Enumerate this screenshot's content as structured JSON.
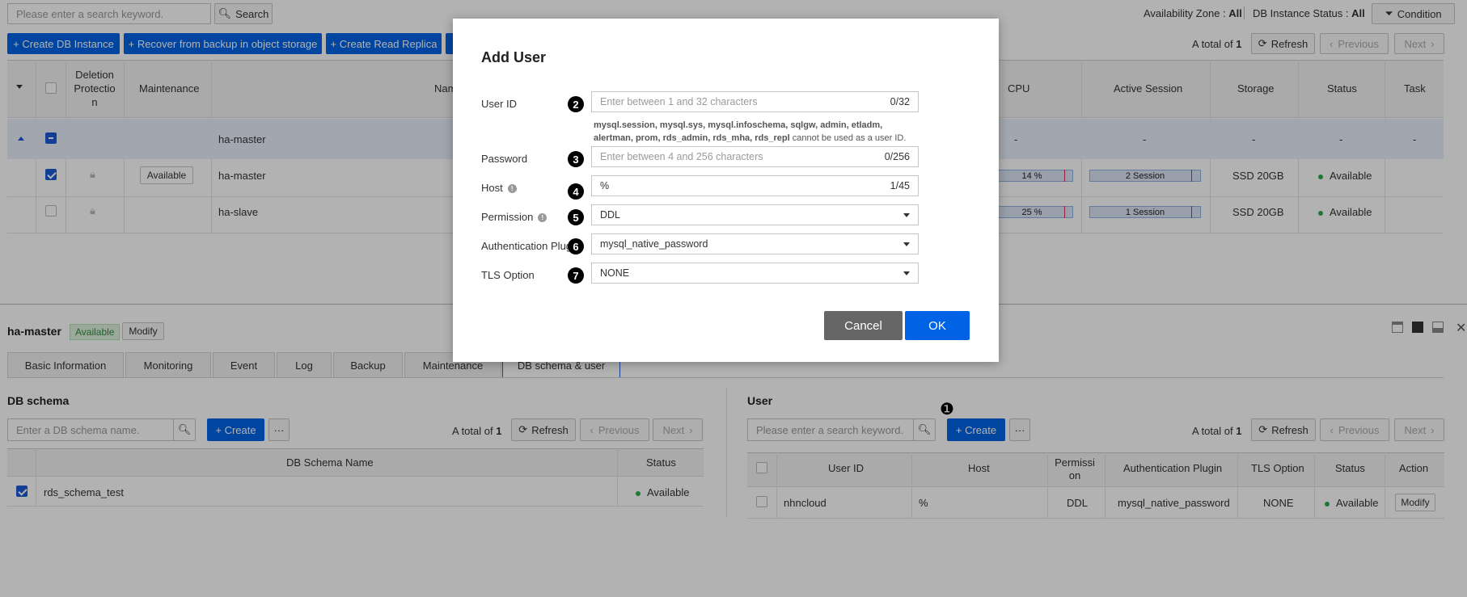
{
  "top_search": {
    "placeholder": "Please enter a search keyword.",
    "button": "Search"
  },
  "filters": {
    "az_label": "Availability Zone :",
    "az_value": "All",
    "status_label": "DB Instance Status :",
    "status_value": "All",
    "condition": "Condition"
  },
  "toolbar": {
    "create": "+ Create DB Instance",
    "recover": "+ Recover from backup in object storage",
    "replica": "+ Create Read Replica",
    "total_label": "A total of",
    "total": "1",
    "refresh": "Refresh",
    "previous": "Previous",
    "next": "Next"
  },
  "instance_table": {
    "headers": {
      "deletion": "Deletion Protectio n",
      "maintenance": "Maintenance",
      "name": "Nam",
      "cpu": "CPU",
      "session": "Active Session",
      "storage": "Storage",
      "status": "Status",
      "task": "Task"
    },
    "group_row": {
      "name": "ha-master",
      "cpu": "-",
      "session": "-",
      "storage": "-",
      "status": "-",
      "task": "-"
    },
    "rows": [
      {
        "maintenance": "Available",
        "name": "ha-master",
        "cpu": "14 %",
        "cpu_pct": 14,
        "session": "2 Session",
        "storage": "SSD 20GB",
        "status": "Available"
      },
      {
        "maintenance": "",
        "name": "ha-slave",
        "cpu": "25 %",
        "cpu_pct": 25,
        "session": "1 Session",
        "storage": "SSD 20GB",
        "status": "Available"
      }
    ]
  },
  "detail": {
    "name": "ha-master",
    "badge": "Available",
    "modify": "Modify",
    "tabs": [
      "Basic Information",
      "Monitoring",
      "Event",
      "Log",
      "Backup",
      "Maintenance",
      "DB schema & user"
    ]
  },
  "schema": {
    "title": "DB schema",
    "placeholder": "Enter a DB schema name.",
    "create": "+ Create",
    "more": "···",
    "total_label": "A total of",
    "total": "1",
    "refresh": "Refresh",
    "previous": "Previous",
    "next": "Next",
    "headers": {
      "name": "DB Schema Name",
      "status": "Status"
    },
    "rows": [
      {
        "name": "rds_schema_test",
        "status": "Available"
      }
    ]
  },
  "user": {
    "title": "User",
    "placeholder": "Please enter a search keyword.",
    "create": "+ Create",
    "more": "···",
    "total_label": "A total of",
    "total": "1",
    "refresh": "Refresh",
    "previous": "Previous",
    "next": "Next",
    "headers": {
      "id": "User ID",
      "host": "Host",
      "perm": "Permissi on",
      "auth": "Authentication Plugin",
      "tls": "TLS Option",
      "status": "Status",
      "action": "Action"
    },
    "rows": [
      {
        "id": "nhncloud",
        "host": "%",
        "perm": "DDL",
        "auth": "mysql_native_password",
        "tls": "NONE",
        "status": "Available",
        "action": "Modify"
      }
    ]
  },
  "modal": {
    "title": "Add User",
    "user_id": {
      "label": "User ID",
      "placeholder": "Enter between 1 and 32 characters",
      "count": "0/32"
    },
    "reserved": {
      "names": "mysql.session, mysql.sys, mysql.infoschema, sqlgw, admin, etladm, alertman, prom, rds_admin, rds_mha, rds_repl",
      "suffix": " cannot be used as a user ID."
    },
    "password": {
      "label": "Password",
      "placeholder": "Enter between 4 and 256 characters",
      "count": "0/256"
    },
    "host": {
      "label": "Host",
      "value": "%",
      "count": "1/45"
    },
    "permission": {
      "label": "Permission",
      "value": "DDL"
    },
    "auth_plugin": {
      "label": "Authentication Plugin",
      "value": "mysql_native_password"
    },
    "tls": {
      "label": "TLS Option",
      "value": "NONE"
    },
    "cancel": "Cancel",
    "ok": "OK"
  },
  "markers": [
    "❶",
    "❷",
    "❸",
    "❹",
    "❺",
    "❻",
    "❼"
  ]
}
